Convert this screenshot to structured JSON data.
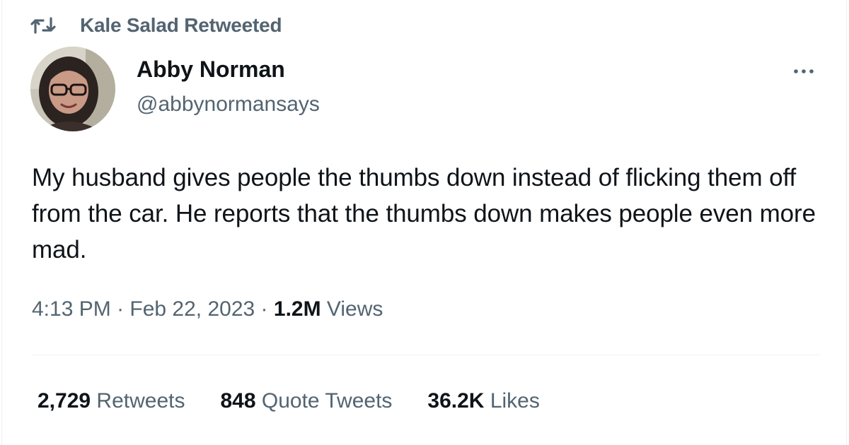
{
  "retweet": {
    "icon": "retweet-icon",
    "label": "Kale Salad Retweeted"
  },
  "author": {
    "avatar": "avatar-photo",
    "display_name": "Abby Norman",
    "handle": "@abbynormansays"
  },
  "more_icon": "more-icon",
  "tweet": {
    "text": "My husband gives people the thumbs down instead of flicking them off from the car. He reports that the thumbs down makes people even more mad."
  },
  "meta": {
    "time": "4:13 PM",
    "sep1": " · ",
    "date": "Feb 22, 2023",
    "sep2": " · ",
    "views_count": "1.2M",
    "views_label": " Views"
  },
  "stats": {
    "retweets_count": "2,729",
    "retweets_label": " Retweets",
    "quotes_count": "848",
    "quotes_label": " Quote Tweets",
    "likes_count": "36.2K",
    "likes_label": " Likes"
  },
  "colors": {
    "text": "#0f1419",
    "secondary": "#536471",
    "divider": "#eff3f4"
  }
}
